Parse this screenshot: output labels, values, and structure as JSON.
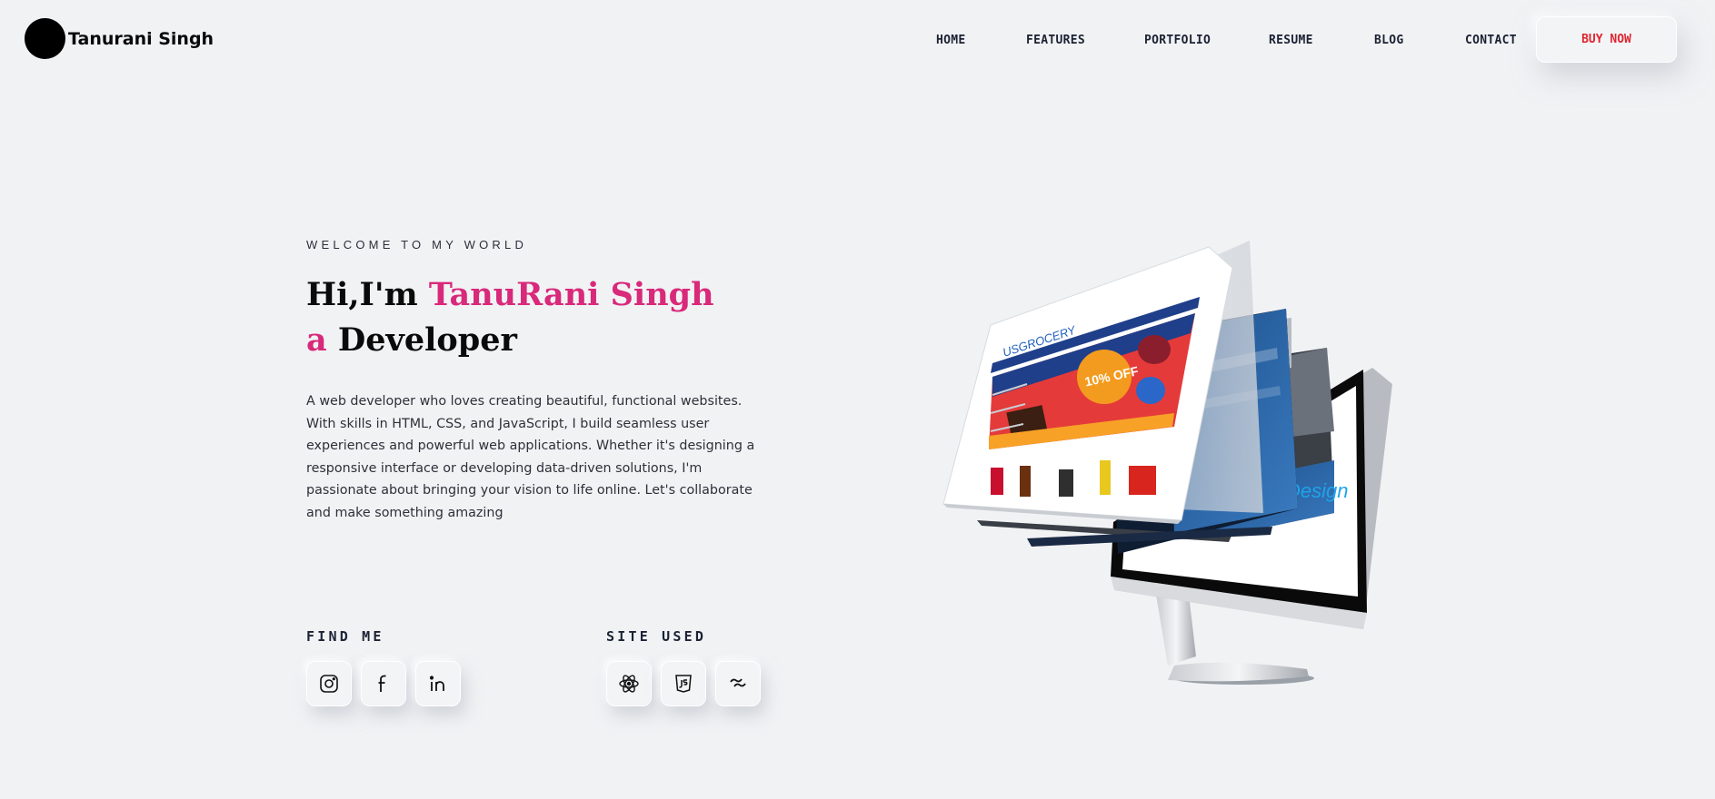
{
  "header": {
    "logo_text": "Tanurani Singh",
    "nav": {
      "home": "HOME",
      "features": "FEATURES",
      "portfolio": "PORTFOLIO",
      "resume": "RESUME",
      "blog": "BLOG",
      "contact": "CONTACT"
    },
    "buy_now": "BUY NOW"
  },
  "hero": {
    "eyebrow": "WELCOME TO MY WORLD",
    "line1_prefix": "Hi,I'm ",
    "line1_name": "TanuRani Singh",
    "line2_prefix": "a ",
    "line2_role": "Developer",
    "description": "A web developer who loves creating beautiful, functional websites. With skills in HTML, CSS, and JavaScript, I build seamless user experiences and powerful web applications. Whether it's designing a responsive interface or developing data-driven solutions, I'm passionate about bringing your vision to life online. Let's collaborate and make something amazing"
  },
  "find_me": {
    "label": "FIND ME",
    "icons": [
      "instagram-icon",
      "facebook-icon",
      "linkedin-icon"
    ]
  },
  "site_used": {
    "label": "SITE USED",
    "icons": [
      "react-icon",
      "javascript-icon",
      "tailwind-icon"
    ]
  },
  "illustration": {
    "banner_text": "10% OFF",
    "brand_text": "USGROCERY",
    "design_text": "Design"
  },
  "colors": {
    "accent": "#d8297a",
    "buy_button": "#e0242f",
    "background": "#f1f2f4"
  }
}
